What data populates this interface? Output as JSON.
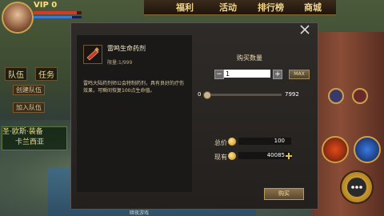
{
  "hud": {
    "vip": "VIP 0",
    "tabs": [
      "福利",
      "活动",
      "排行榜",
      "商城"
    ],
    "left_tabs": [
      "队伍",
      "任务"
    ],
    "buttons": [
      "创建队伍",
      "加入队伍"
    ],
    "quest_lines": [
      "圣·欧斯·装备",
      "卡兰西亚"
    ],
    "bottom_hint": "暗夜游戏"
  },
  "dialog": {
    "item_name": "雷鸣生命药剂",
    "stock": "限量:1/999",
    "description": "雷鸣大陆药剂师公会特制药剂，具有良好的疗伤效果，可瞬间恢复100点生命值。",
    "buy_quantity_label": "购买数量",
    "quantity_value": "1",
    "max_label": "MAX",
    "slider_min": "0",
    "slider_max": "7992",
    "total_label": "总价",
    "total_value": "100",
    "owned_label": "现有",
    "owned_value": "40085",
    "buy_label": "购买"
  },
  "colors": {
    "accent_gold": "#c9a252",
    "panel_bg": "#2e2b28"
  }
}
